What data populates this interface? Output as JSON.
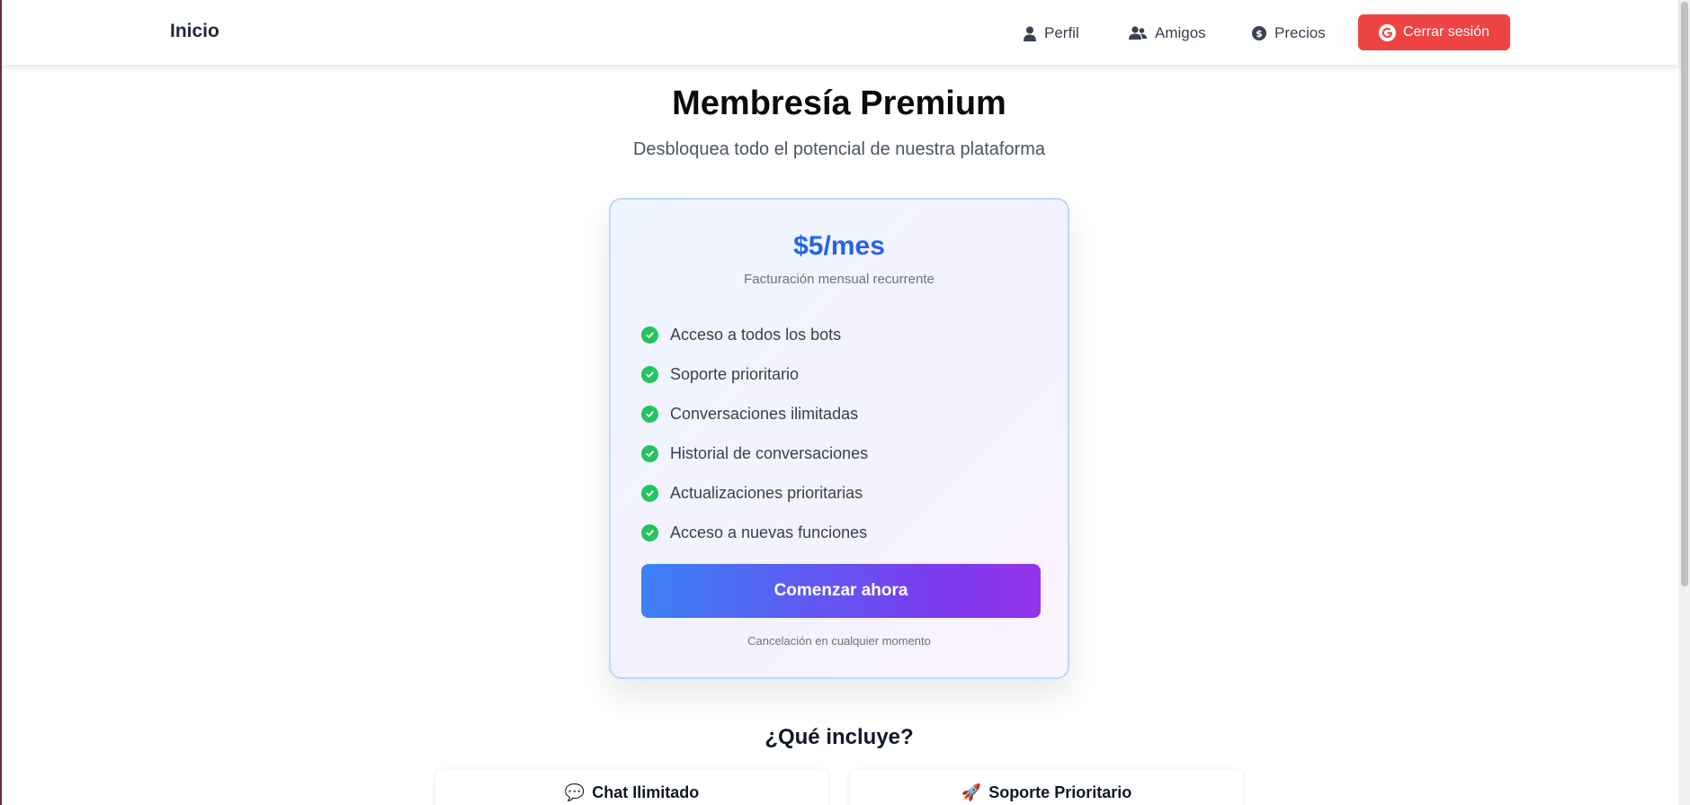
{
  "navbar": {
    "brand": "Inicio",
    "items": [
      {
        "label": "Perfil",
        "icon": "user-icon"
      },
      {
        "label": "Amigos",
        "icon": "users-icon"
      },
      {
        "label": "Precios",
        "icon": "dollar-circle-icon"
      }
    ],
    "logout": {
      "label": "Cerrar sesión",
      "icon": "google-icon",
      "color": "#ef4444"
    }
  },
  "header": {
    "title": "Membresía Premium",
    "subtitle": "Desbloquea todo el potencial de nuestra plataforma"
  },
  "plan": {
    "price": "$5/mes",
    "billing": "Facturación mensual recurrente",
    "features": [
      "Acceso a todos los bots",
      "Soporte prioritario",
      "Conversaciones ilimitadas",
      "Historial de conversaciones",
      "Actualizaciones prioritarias",
      "Acceso a nuevas funciones"
    ],
    "cta_label": "Comenzar ahora",
    "cancel_note": "Cancelación en cualquier momento",
    "accent_color": "#2563eb",
    "check_color": "#22c55e"
  },
  "includes": {
    "title": "¿Qué incluye?",
    "cards": [
      {
        "icon": "💬",
        "icon_name": "speech-bubble-icon",
        "title": "Chat Ilimitado"
      },
      {
        "icon": "🚀",
        "icon_name": "rocket-icon",
        "title": "Soporte Prioritario"
      }
    ]
  }
}
